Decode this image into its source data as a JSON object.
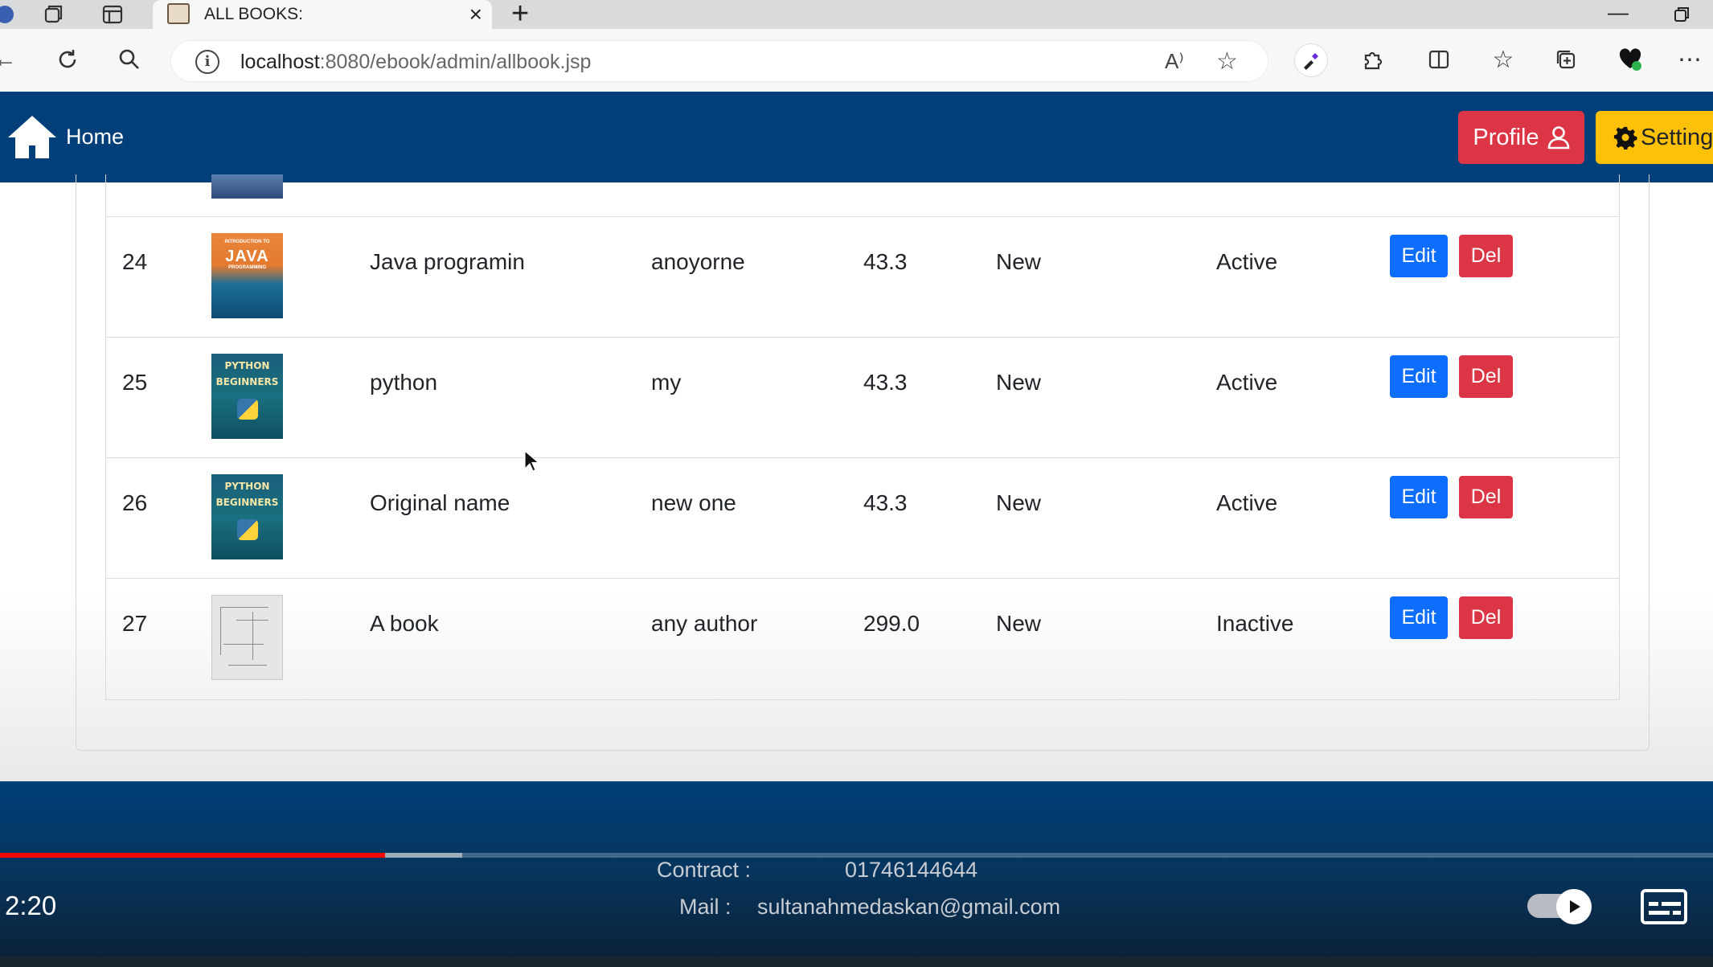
{
  "browser": {
    "tab_title": "ALL BOOKS:",
    "url_host": "localhost",
    "url_path": ":8080/ebook/admin/allbook.jsp"
  },
  "header": {
    "home_label": "Home",
    "profile_label": "Profile",
    "setting_label": "Setting"
  },
  "books": [
    {
      "id": "24",
      "name": "Java programin",
      "author": "anoyorne",
      "price": "43.3",
      "category": "New",
      "status": "Active",
      "cover": "java",
      "edit_label": "Edit",
      "del_label": "Del"
    },
    {
      "id": "25",
      "name": "python",
      "author": "my",
      "price": "43.3",
      "category": "New",
      "status": "Active",
      "cover": "python",
      "edit_label": "Edit",
      "del_label": "Del"
    },
    {
      "id": "26",
      "name": "Original name",
      "author": "new one",
      "price": "43.3",
      "category": "New",
      "status": "Active",
      "cover": "python",
      "edit_label": "Edit",
      "del_label": "Del"
    },
    {
      "id": "27",
      "name": "A book",
      "author": "any author",
      "price": "299.0",
      "category": "New",
      "status": "Inactive",
      "cover": "sketch",
      "edit_label": "Edit",
      "del_label": "Del"
    }
  ],
  "covers": {
    "java_line1": "INTRODUCTION TO",
    "java_title": "JAVA",
    "java_line2": "PROGRAMMING",
    "python_line1": "PYTHON",
    "python_line2": "BEGINNERS"
  },
  "footer": {
    "contact_label": "Contract :",
    "contact_value": "01746144644",
    "mail_label": "Mail :",
    "mail_value": "sultanahmedaskan@gmail.com"
  },
  "video": {
    "time": "2:20",
    "played_fraction": 0.225,
    "buffered_fraction": 0.27
  },
  "colors": {
    "header_bg": "#003f79",
    "edit_btn": "#0d6efd",
    "del_btn": "#dc3545",
    "profile_btn": "#dc3545",
    "setting_btn": "#ffc107",
    "progress": "#ff0000"
  }
}
